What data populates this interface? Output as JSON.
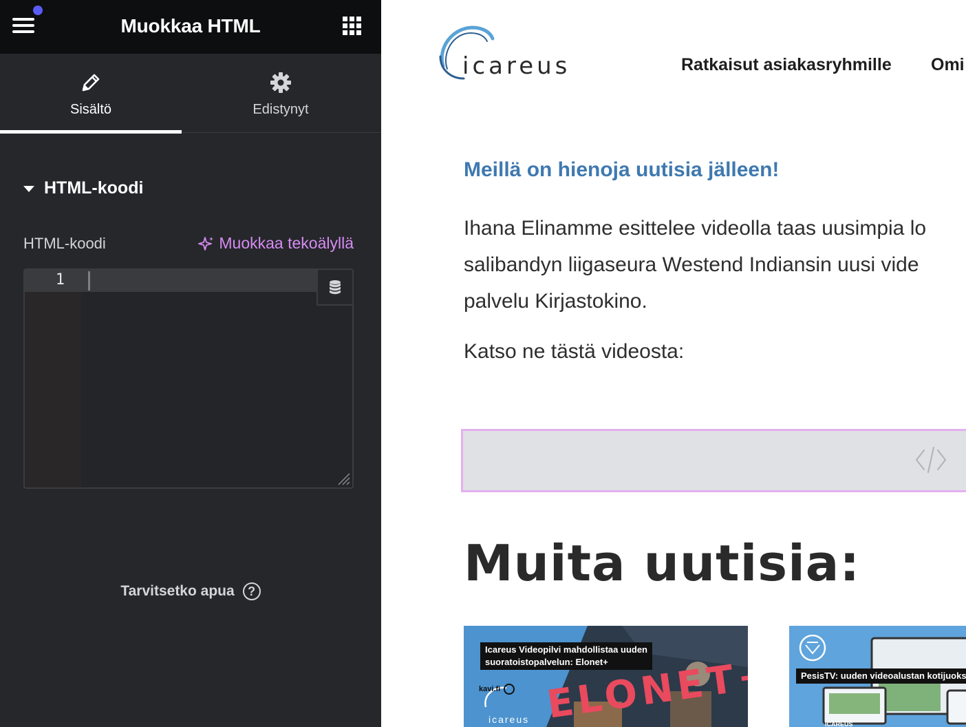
{
  "editor": {
    "title": "Muokkaa HTML",
    "tabs": [
      {
        "label": "Sisältö",
        "icon": "pencil-icon",
        "active": true
      },
      {
        "label": "Edistynyt",
        "icon": "gear-icon",
        "active": false
      }
    ],
    "section_title": "HTML-koodi",
    "field_label": "HTML-koodi",
    "ai_button_label": "Muokkaa tekoälyllä",
    "code": {
      "line_number": "1",
      "value": ""
    },
    "help_label": "Tarvitsetko apua",
    "help_icon_glyph": "?",
    "collapse_glyph": "‹"
  },
  "site": {
    "logo_text": "icareus",
    "nav": [
      "Ratkaisut asiakasryhmille",
      "Omi"
    ],
    "headline": "Meillä on hienoja uutisia jälleen!",
    "body_lines": [
      "Ihana Elinamme esittelee videolla taas uusimpia lo",
      "salibandyn liigaseura Westend Indiansin uusi vide",
      "palvelu Kirjastokino."
    ],
    "cta": "Katso ne tästä videosta:",
    "other_news_title": "Muita uutisia:",
    "cards": [
      {
        "caption_lines": [
          "Icareus Videopilvi mahdollistaa uuden",
          "suoratoistopalvelun: Elonet+"
        ],
        "badge": "kavi.fi",
        "brand_text": "ELONET+",
        "logo_text": "icareus"
      },
      {
        "caption_lines": [
          "PesisTV: uuden videoalustan kotijuoks"
        ],
        "logo_text": "ICAREUS"
      }
    ]
  },
  "colors": {
    "panel_bg": "#26272b",
    "header_bg": "#0d0e10",
    "ai_accent": "#d58cf2",
    "headline_blue": "#3f79b0",
    "notification_dot": "#5a5cf5"
  }
}
